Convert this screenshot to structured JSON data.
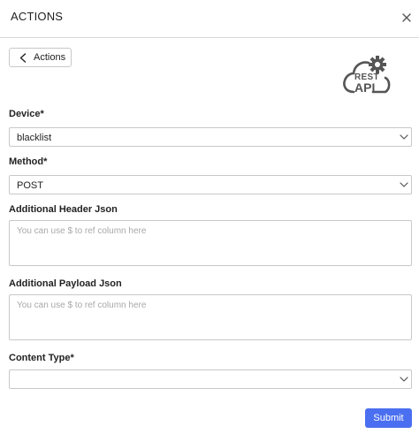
{
  "header": {
    "title": "ACTIONS"
  },
  "back_button": {
    "label": "Actions"
  },
  "logo": {
    "line1": "REST",
    "line2": "API"
  },
  "form": {
    "device": {
      "label": "Device*",
      "value": "blacklist"
    },
    "method": {
      "label": "Method*",
      "value": "POST"
    },
    "additional_header_json": {
      "label": "Additional Header Json",
      "placeholder": "You can use $ to ref column here",
      "value": ""
    },
    "additional_payload_json": {
      "label": "Additional Payload Json",
      "placeholder": "You can use $ to ref column here",
      "value": ""
    },
    "content_type": {
      "label": "Content Type*",
      "value": ""
    },
    "submit_label": "Submit"
  },
  "colors": {
    "primary": "#4a6ff0",
    "border": "#c8c8c8",
    "placeholder": "#a8a8a8"
  }
}
